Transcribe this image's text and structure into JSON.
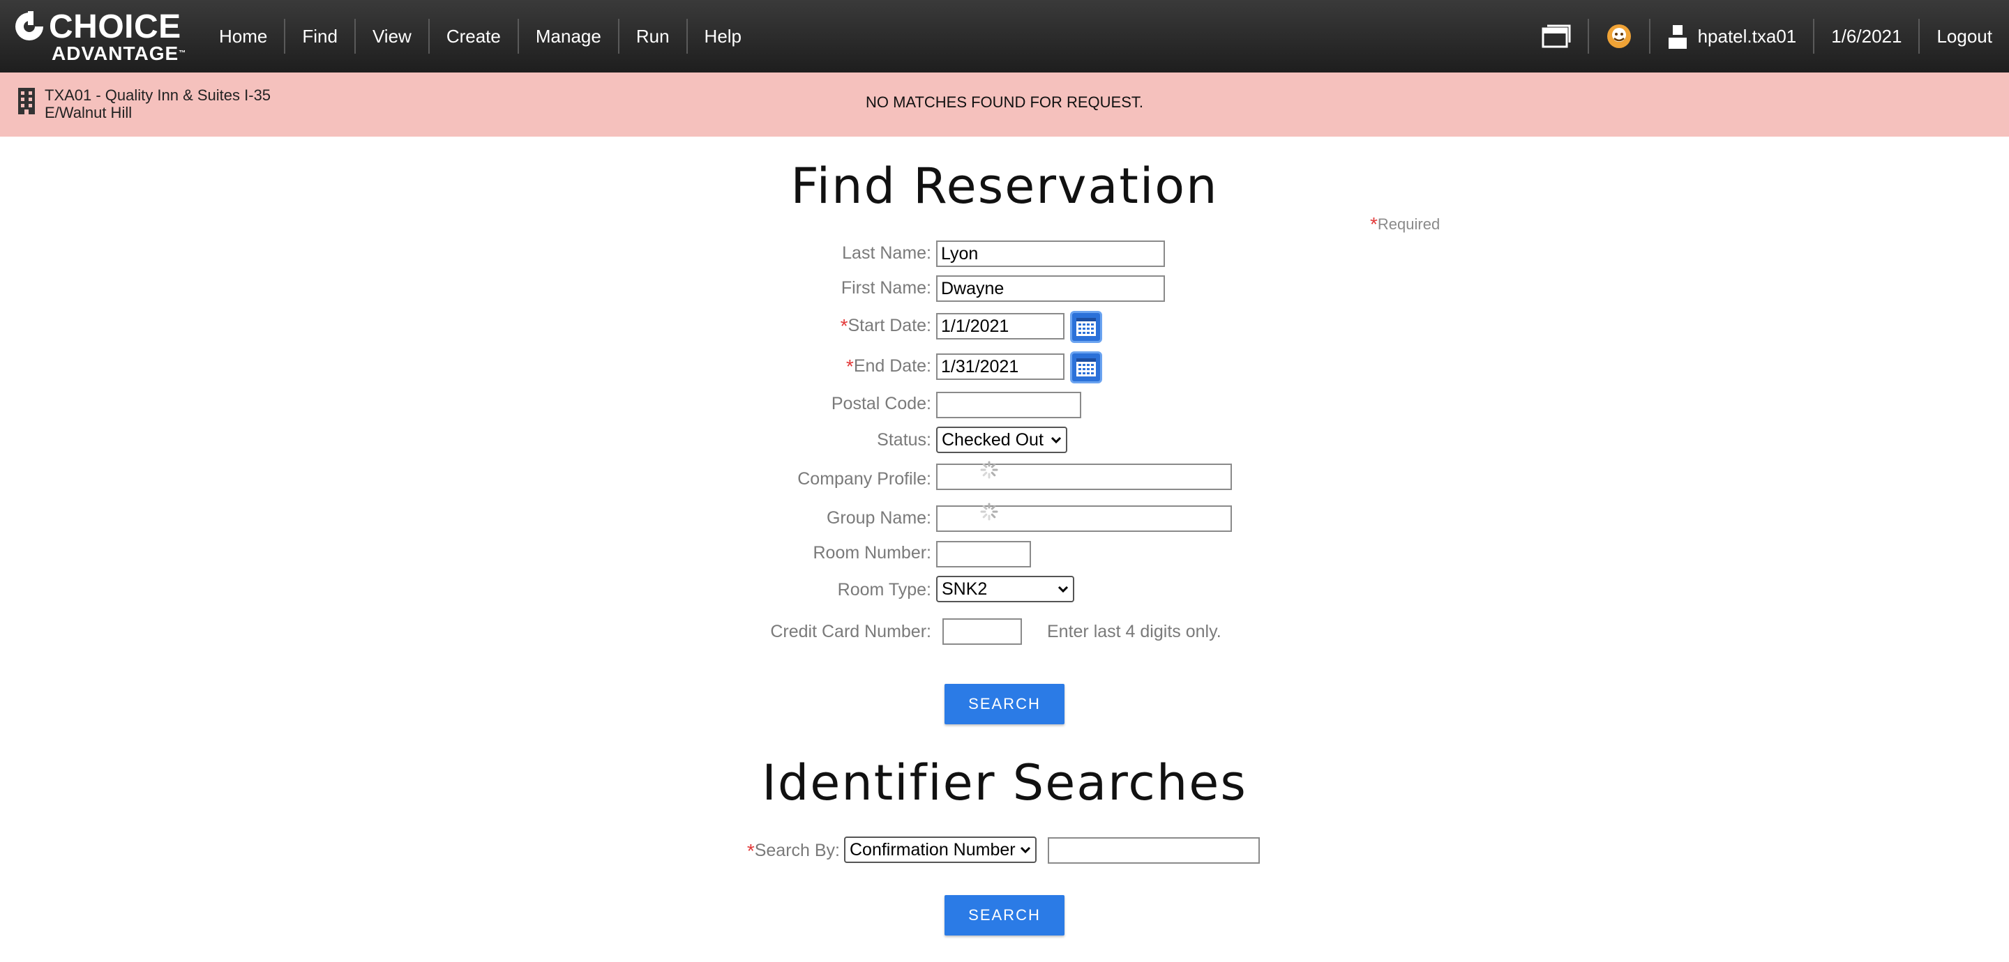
{
  "brand": {
    "name_top": "CHOICE",
    "name_bottom": "ADVANTAGE",
    "tm": "™"
  },
  "nav": {
    "items": [
      "Home",
      "Find",
      "View",
      "Create",
      "Manage",
      "Run",
      "Help"
    ]
  },
  "user": {
    "name": "hpatel.txa01",
    "date": "1/6/2021",
    "logout": "Logout"
  },
  "property": {
    "name": "TXA01 - Quality Inn & Suites I-35 E/Walnut Hill"
  },
  "alert": {
    "message": "NO MATCHES FOUND FOR REQUEST."
  },
  "find_reservation": {
    "title": "Find Reservation",
    "required_note": "Required",
    "required_star": "*",
    "fields": {
      "last_name": {
        "label": "Last Name:",
        "value": "Lyon"
      },
      "first_name": {
        "label": "First Name:",
        "value": "Dwayne"
      },
      "start_date": {
        "label": "Start Date:",
        "value": "1/1/2021"
      },
      "end_date": {
        "label": "End Date:",
        "value": "1/31/2021"
      },
      "postal_code": {
        "label": "Postal Code:",
        "value": ""
      },
      "status": {
        "label": "Status:",
        "value": "Checked Out"
      },
      "company_profile": {
        "label": "Company Profile:",
        "value": ""
      },
      "group_name": {
        "label": "Group Name:",
        "value": ""
      },
      "room_number": {
        "label": "Room Number:",
        "value": ""
      },
      "room_type": {
        "label": "Room Type:",
        "value": "SNK2"
      },
      "credit_card": {
        "label": "Credit Card Number:",
        "value": "",
        "hint": "Enter last 4 digits only."
      }
    },
    "search_button": "SEARCH"
  },
  "identifier_searches": {
    "title": "Identifier Searches",
    "search_by": {
      "label": "Search By:",
      "value": "Confirmation Number"
    },
    "identifier_value": "",
    "search_button": "SEARCH"
  },
  "icons": {
    "calendar": "calendar-icon",
    "spinner": "loading-spinner-icon",
    "window": "window-icon",
    "status": "status-face-icon",
    "user": "user-icon",
    "property": "building-icon"
  },
  "colors": {
    "accent": "#2b7be6",
    "alert_bg": "#f5c1bd",
    "required": "#e23a3a"
  }
}
